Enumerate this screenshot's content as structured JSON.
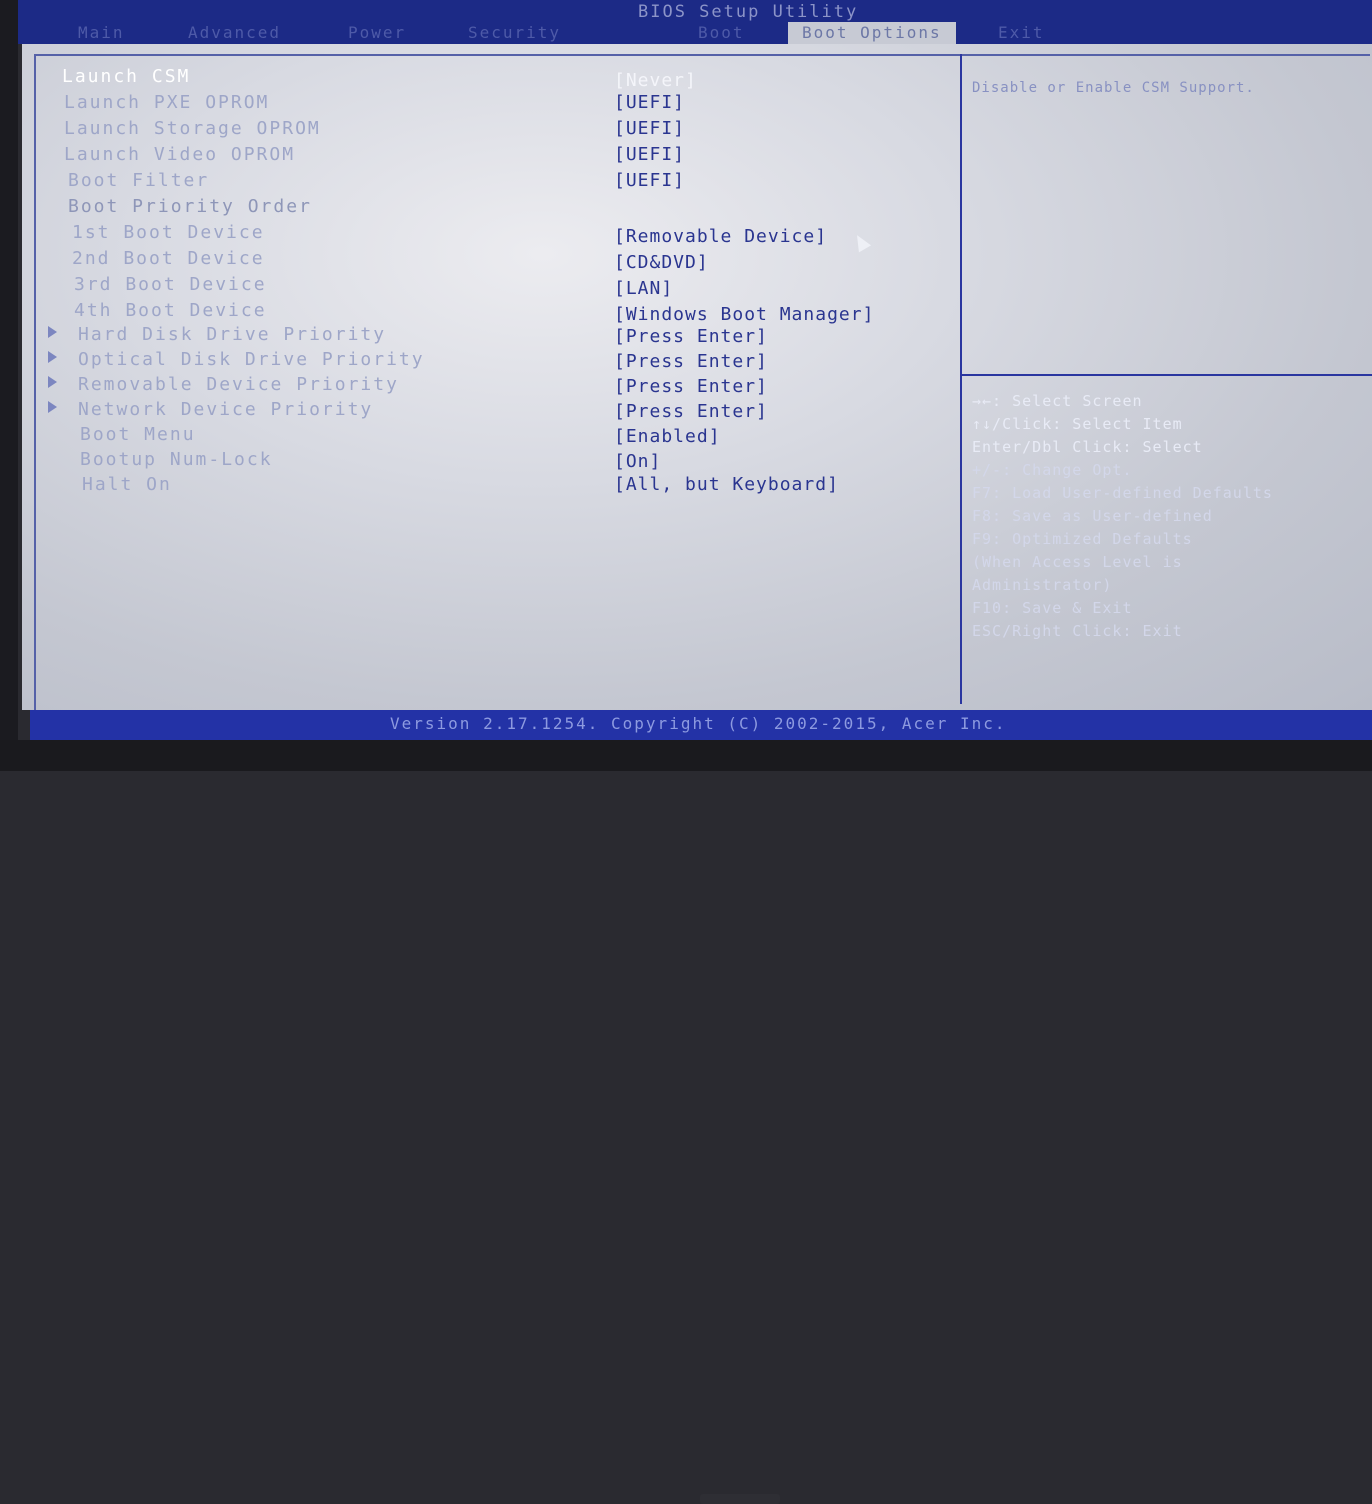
{
  "window_title": "BIOS Setup Utility",
  "tabs": [
    {
      "label": "Main"
    },
    {
      "label": "Advanced"
    },
    {
      "label": "Power"
    },
    {
      "label": "Security"
    },
    {
      "label": "Boot"
    },
    {
      "label": "Boot Options"
    },
    {
      "label": "Exit"
    }
  ],
  "active_tab": "Boot Options",
  "settings": [
    {
      "label": "Launch CSM",
      "value": "[Never]"
    },
    {
      "label": "Launch PXE OPROM",
      "value": "[UEFI]"
    },
    {
      "label": "Launch Storage OPROM",
      "value": "[UEFI]"
    },
    {
      "label": "Launch Video OPROM",
      "value": "[UEFI]"
    },
    {
      "label": "Boot Filter",
      "value": "[UEFI]"
    },
    {
      "label": "Boot Priority Order",
      "value": ""
    },
    {
      "label": "1st Boot Device",
      "value": "[Removable Device]"
    },
    {
      "label": "2nd Boot Device",
      "value": "[CD&DVD]"
    },
    {
      "label": "3rd Boot Device",
      "value": "[LAN]"
    },
    {
      "label": "4th Boot Device",
      "value": "[Windows Boot Manager]"
    },
    {
      "label": "Hard Disk Drive Priority",
      "value": "[Press Enter]"
    },
    {
      "label": "Optical Disk Drive Priority",
      "value": "[Press Enter]"
    },
    {
      "label": "Removable Device Priority",
      "value": "[Press Enter]"
    },
    {
      "label": "Network Device Priority",
      "value": "[Press Enter]"
    },
    {
      "label": "Boot Menu",
      "value": "[Enabled]"
    },
    {
      "label": "Bootup Num-Lock",
      "value": "[On]"
    },
    {
      "label": "Halt On",
      "value": "[All, but Keyboard]"
    }
  ],
  "help": {
    "description": "Disable or Enable CSM Support.",
    "keys": [
      "→←: Select Screen",
      "↑↓/Click: Select Item",
      "Enter/Dbl Click: Select",
      "+/-: Change Opt.",
      "F7: Load User-defined Defaults",
      "F8: Save as User-defined",
      "F9: Optimized Defaults",
      "(When Access Level is",
      "Administrator)",
      "F10: Save & Exit",
      "ESC/Right Click: Exit"
    ]
  },
  "footer": {
    "version": "Version 2.17.1254. Copyright (C) 2002-2015, Acer Inc."
  },
  "colors": {
    "bar_blue": "#1c2a86",
    "screen_gray": "#c9ccd5",
    "value_blue": "#2a3590"
  }
}
